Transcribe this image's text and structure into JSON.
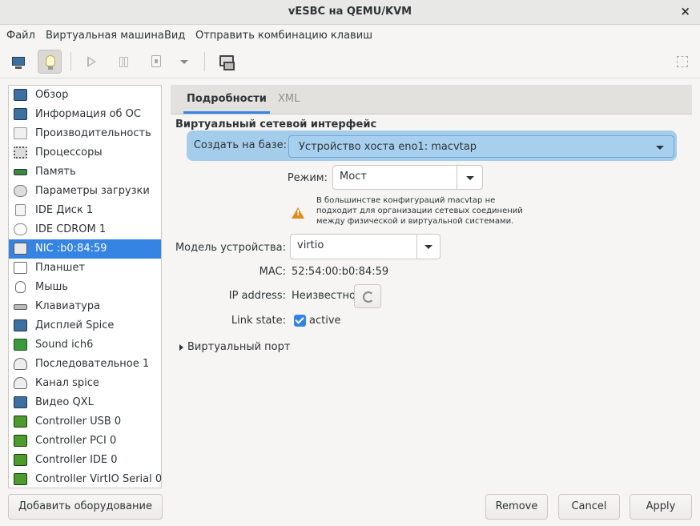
{
  "window": {
    "title": "vESBC на QEMU/KVM",
    "close_glyph": "×"
  },
  "menu": {
    "items": [
      "Файл",
      "Виртуальная машина",
      "Вид",
      "Отправить комбинацию клавиш"
    ]
  },
  "toolbar": {
    "icons": [
      "monitor-icon",
      "lightbulb-icon",
      "play-icon",
      "pause-icon",
      "shutdown-icon",
      "dropdown-arrow-icon",
      "screenshot-icon",
      "fullscreen-icon"
    ]
  },
  "hardware_list": {
    "items": [
      {
        "label": "Обзор",
        "icon": "monitor-icon"
      },
      {
        "label": "Информация об ОС",
        "icon": "monitor-icon"
      },
      {
        "label": "Производительность",
        "icon": "gauge-icon"
      },
      {
        "label": "Процессоры",
        "icon": "cpu-icon"
      },
      {
        "label": "Память",
        "icon": "memory-icon"
      },
      {
        "label": "Параметры загрузки",
        "icon": "gear-icon"
      },
      {
        "label": "IDE Диск 1",
        "icon": "disk-icon"
      },
      {
        "label": "IDE CDROM 1",
        "icon": "cdrom-icon"
      },
      {
        "label": "NIC :b0:84:59",
        "icon": "network-icon",
        "selected": true
      },
      {
        "label": "Планшет",
        "icon": "tablet-icon"
      },
      {
        "label": "Мышь",
        "icon": "mouse-icon"
      },
      {
        "label": "Клавиатура",
        "icon": "keyboard-icon"
      },
      {
        "label": "Дисплей Spice",
        "icon": "monitor-icon"
      },
      {
        "label": "Sound ich6",
        "icon": "sound-icon"
      },
      {
        "label": "Последовательное 1",
        "icon": "serial-icon"
      },
      {
        "label": "Канал spice",
        "icon": "serial-icon"
      },
      {
        "label": "Видео QXL",
        "icon": "monitor-icon"
      },
      {
        "label": "Controller USB 0",
        "icon": "controller-icon"
      },
      {
        "label": "Controller PCI 0",
        "icon": "controller-icon"
      },
      {
        "label": "Controller IDE 0",
        "icon": "controller-icon"
      },
      {
        "label": "Controller VirtIO Serial 0",
        "icon": "controller-icon"
      }
    ]
  },
  "tabs": {
    "details": "Подробности",
    "xml": "XML"
  },
  "nic": {
    "section_title": "Виртуальный сетевой интерфейс",
    "source_label": "Создать на базе:",
    "source_value": "Устройство хоста eno1: macvtap",
    "mode_label": "Режим:",
    "mode_value": "Мост",
    "warning_line1": "В большинстве конфигураций macvtap не",
    "warning_line2": "подходит для организации сетевых соединений",
    "warning_line3": "между физической и виртуальной системами.",
    "model_label": "Модель устройства:",
    "model_value": "virtio",
    "mac_label": "MAC:",
    "mac_value": "52:54:00:b0:84:59",
    "ip_label": "IP address:",
    "ip_value": "Неизвестно",
    "link_label": "Link state:",
    "link_value": "active",
    "link_checked": true,
    "virtual_port_label": "Виртуальный порт"
  },
  "buttons": {
    "add_hardware": "Добавить оборудование",
    "remove": "Remove",
    "cancel": "Cancel",
    "apply": "Apply"
  },
  "colors": {
    "accent": "#3584e4",
    "highlight_row": "#a4cdeb",
    "warning": "#e18d1a"
  }
}
